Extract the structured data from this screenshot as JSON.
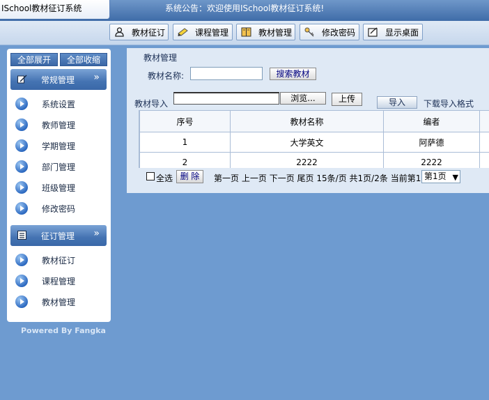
{
  "header": {
    "app_title": "ISchool教材征订系统",
    "notice": "系统公告：欢迎使用ISchool教材征订系统!"
  },
  "nav_tabs": [
    {
      "label": "教材征订",
      "icon": "user-icon"
    },
    {
      "label": "课程管理",
      "icon": "pencil-icon"
    },
    {
      "label": "教材管理",
      "icon": "book-icon"
    },
    {
      "label": "修改密码",
      "icon": "key-icon"
    },
    {
      "label": "显示桌面",
      "icon": "desktop-icon"
    }
  ],
  "sidebar": {
    "expand_all": "全部展开",
    "collapse_all": "全部收缩",
    "groups": [
      {
        "title": "常规管理",
        "icon": "feather-icon",
        "items": [
          "系统设置",
          "教师管理",
          "学期管理",
          "部门管理",
          "班级管理",
          "修改密码"
        ]
      },
      {
        "title": "征订管理",
        "icon": "list-icon",
        "items": [
          "教材征订",
          "课程管理",
          "教材管理"
        ]
      }
    ],
    "chevron": "»",
    "powered": "Powered By Fangka"
  },
  "main": {
    "breadcrumb": "教材管理",
    "search": {
      "label": "教材名称:",
      "value": "",
      "button": "搜索教材"
    },
    "import": {
      "label": "教材导入",
      "browse": "浏览...",
      "upload": "上传",
      "import_button": "导入",
      "template_link": "下载导入格式"
    },
    "table": {
      "columns": [
        "序号",
        "教材名称",
        "编者"
      ],
      "rows": [
        [
          "1",
          "大学英文",
          "阿萨德"
        ],
        [
          "2",
          "2222",
          "2222"
        ]
      ]
    },
    "pager": {
      "select_all": "全选",
      "delete": "删 除",
      "first": "第一页",
      "prev": "上一页",
      "next": "下一页",
      "last": "尾页",
      "per_page": "15条/页",
      "total": "共1页/2条",
      "current": "当前第1页",
      "page_select": "第1页"
    }
  },
  "colors": {
    "background": "#6e9bd0",
    "header": "#3f6ca8",
    "panel": "#dfe9f5"
  }
}
